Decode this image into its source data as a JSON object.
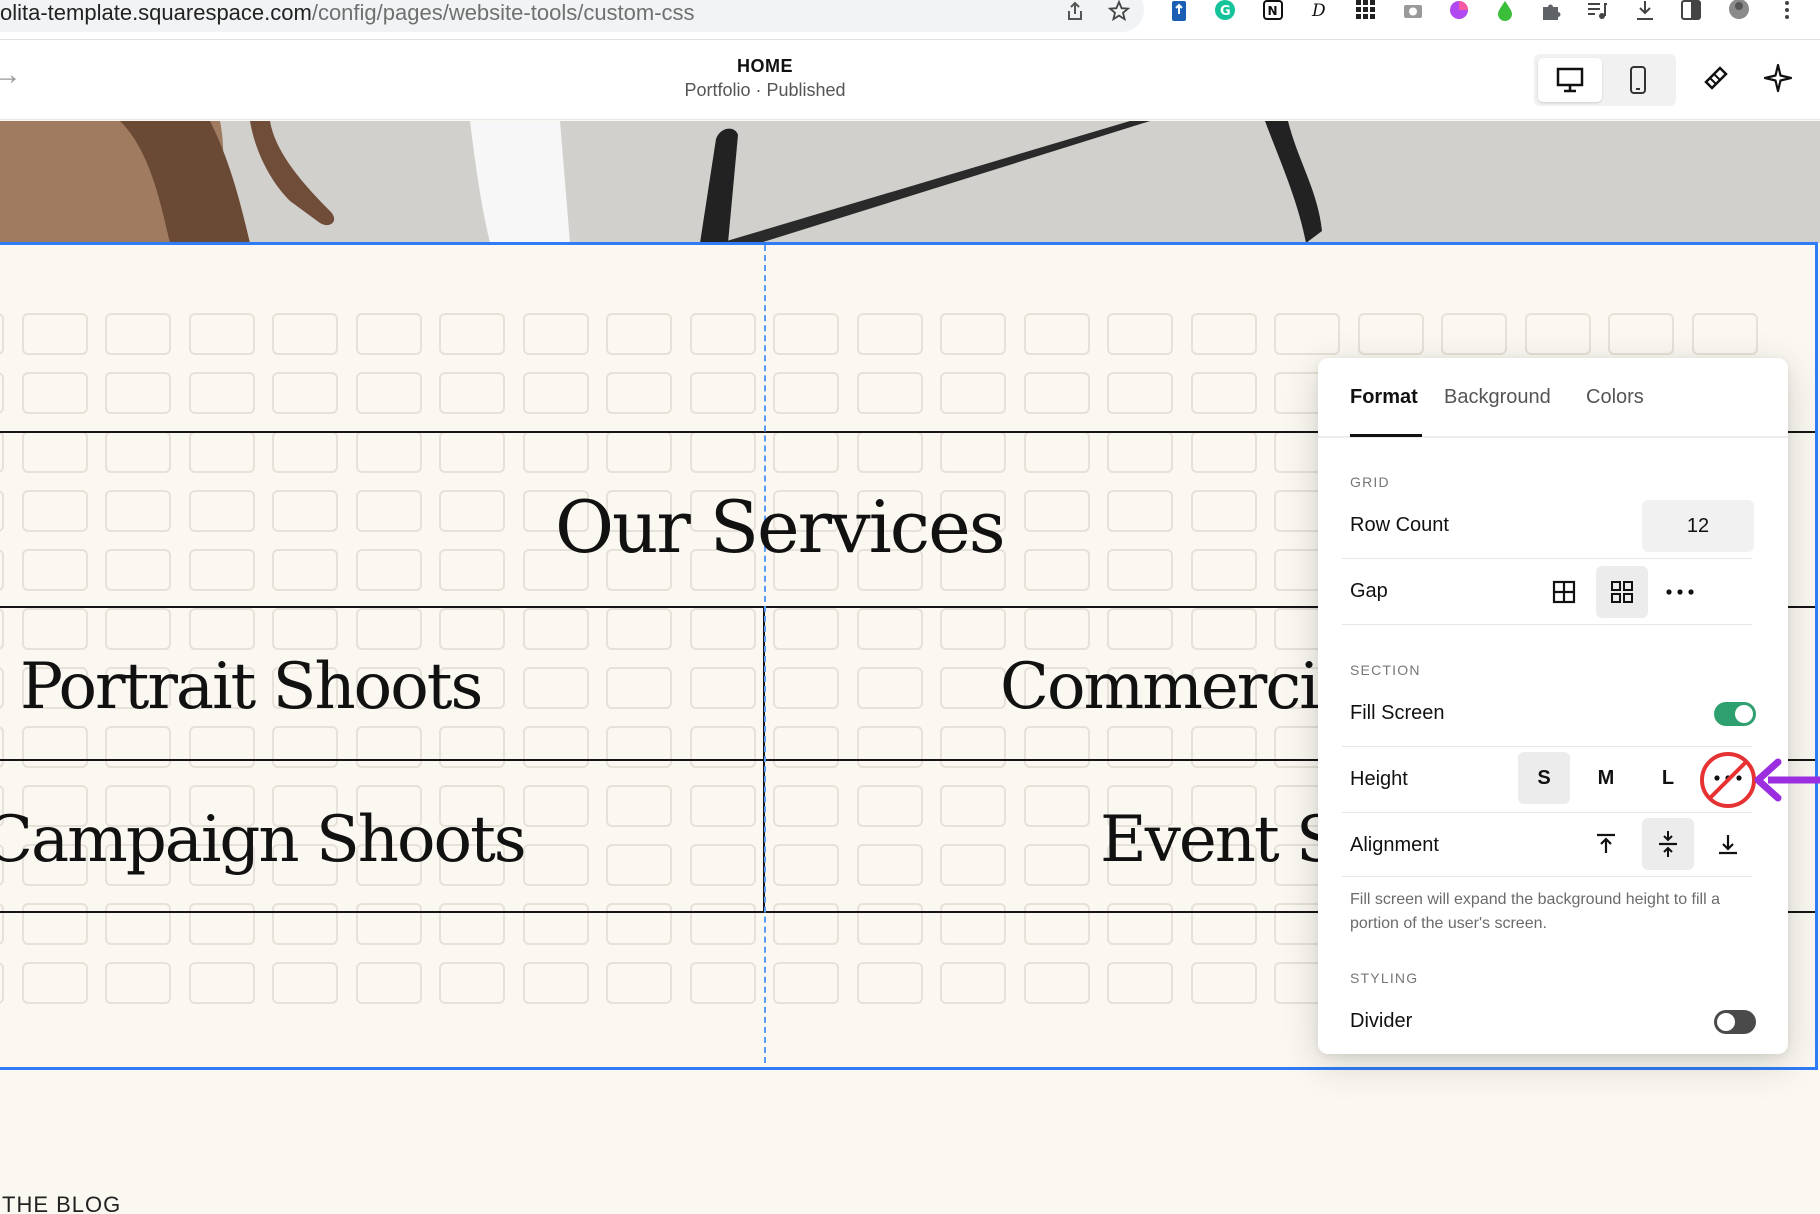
{
  "browser": {
    "url_host": "olita-template.squarespace.com",
    "url_path": "/config/pages/website-tools/custom-css"
  },
  "editor_header": {
    "page_title": "HOME",
    "page_subtitle": "Portfolio · Published"
  },
  "section": {
    "heading": "Our Services",
    "services": [
      "Portrait Shoots",
      "Commerci",
      "Campaign Shoots",
      "Event S"
    ]
  },
  "footer_peek": {
    "label": "THE BLOG"
  },
  "panel": {
    "tabs": [
      {
        "label": "Format",
        "active": true
      },
      {
        "label": "Background",
        "active": false
      },
      {
        "label": "Colors",
        "active": false
      }
    ],
    "grid_group": "GRID",
    "row_count_label": "Row Count",
    "row_count_value": "12",
    "gap_label": "Gap",
    "section_group": "SECTION",
    "fill_screen_label": "Fill Screen",
    "fill_screen_on": true,
    "height_label": "Height",
    "height_options": [
      "S",
      "M",
      "L"
    ],
    "height_selected": "S",
    "alignment_label": "Alignment",
    "help_text": "Fill screen will expand the background height to fill a portion of the user's screen.",
    "styling_group": "STYLING",
    "divider_label": "Divider",
    "divider_on": false
  },
  "colors": {
    "selection_blue": "#2f7cf6",
    "toggle_on": "#2e9f6e",
    "toggle_off": "#4a4a4a",
    "annotation_red": "#e63232",
    "annotation_purple": "#9b2fe0",
    "section_bg": "#fbf8f1"
  },
  "icons": [
    "share-icon",
    "bookmark-star-icon",
    "extension-icons",
    "desktop-icon",
    "mobile-icon",
    "paint-brush-icon",
    "sparkle-icon",
    "gap-large-icon",
    "gap-small-icon",
    "more-dots-icon",
    "align-top-icon",
    "align-middle-icon",
    "align-bottom-icon"
  ]
}
